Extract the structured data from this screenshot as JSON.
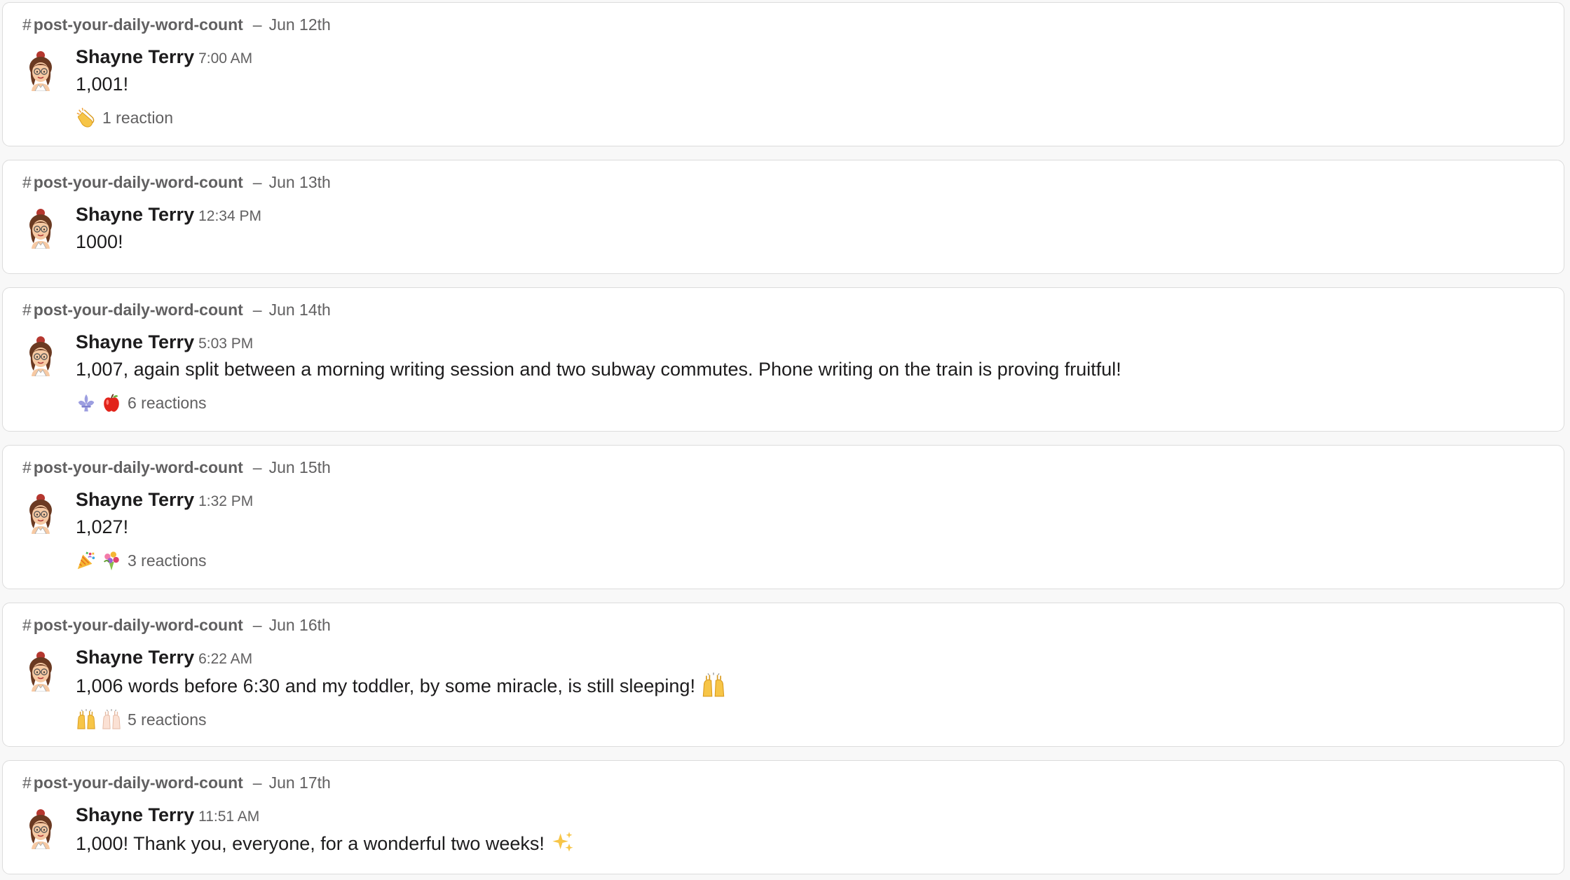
{
  "messages": [
    {
      "hash": "#",
      "channel": "post-your-daily-word-count",
      "separator": "–",
      "date": "Jun 12th",
      "author": "Shayne Terry",
      "time": "7:00 AM",
      "text": "1,001!",
      "reactions": [
        "clap-icon"
      ],
      "reaction_count": "1 reaction"
    },
    {
      "hash": "#",
      "channel": "post-your-daily-word-count",
      "separator": "–",
      "date": "Jun 13th",
      "author": "Shayne Terry",
      "time": "12:34 PM",
      "text": "1000!"
    },
    {
      "hash": "#",
      "channel": "post-your-daily-word-count",
      "separator": "–",
      "date": "Jun 14th",
      "author": "Shayne Terry",
      "time": "5:03 PM",
      "text": "1,007, again split between a morning writing session and two subway commutes. Phone writing on the train is proving fruitful!",
      "reactions": [
        "fleur-de-lis-icon",
        "apple-icon"
      ],
      "reaction_count": "6 reactions"
    },
    {
      "hash": "#",
      "channel": "post-your-daily-word-count",
      "separator": "–",
      "date": "Jun 15th",
      "author": "Shayne Terry",
      "time": "1:32 PM",
      "text": "1,027!",
      "reactions": [
        "party-popper-icon",
        "bouquet-icon"
      ],
      "reaction_count": "3 reactions"
    },
    {
      "hash": "#",
      "channel": "post-your-daily-word-count",
      "separator": "–",
      "date": "Jun 16th",
      "author": "Shayne Terry",
      "time": "6:22 AM",
      "text": "1,006 words before 6:30 and my toddler, by some miracle, is still sleeping!",
      "inline_emoji": "raised-hands-icon",
      "reactions": [
        "raised-hands-icon",
        "raised-hands-light-icon"
      ],
      "reaction_count": "5 reactions"
    },
    {
      "hash": "#",
      "channel": "post-your-daily-word-count",
      "separator": "–",
      "date": "Jun 17th",
      "author": "Shayne Terry",
      "time": "11:51 AM",
      "text": "1,000! Thank you, everyone, for a wonderful two weeks!",
      "inline_emoji": "sparkles-icon"
    }
  ],
  "colors": {
    "background": "#f8f8f8",
    "card": "#ffffff",
    "border": "#dcdcdc",
    "text": "#1d1c1d",
    "muted": "#616061"
  }
}
